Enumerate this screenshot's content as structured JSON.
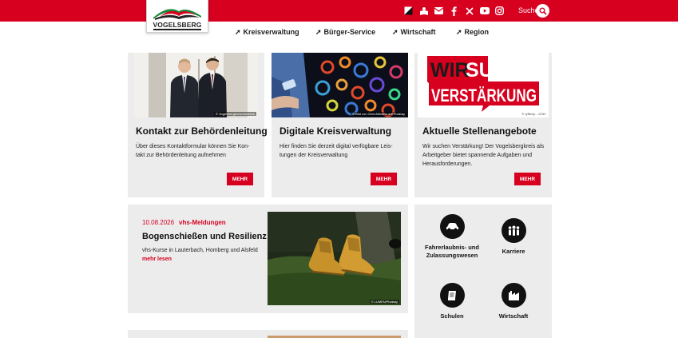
{
  "header": {
    "logo_text": "VOGELSBERG",
    "search_label": "Suche",
    "social": [
      "contrast-icon",
      "easy-language-icon",
      "mail-icon",
      "facebook-icon",
      "x-icon",
      "youtube-icon",
      "instagram-icon"
    ]
  },
  "nav": [
    {
      "label": "Kreisverwaltung"
    },
    {
      "label": "Bürger-Service"
    },
    {
      "label": "Wirtschaft"
    },
    {
      "label": "Region"
    }
  ],
  "cards": [
    {
      "title": "Kontakt zur Behördenleitung",
      "text": "Über dieses Kontaktformular können Sie Kon- takt zur Behördenleitung aufnehmen",
      "button": "MEHR",
      "credit": "© Vogelsbergkreis/Asbeeck"
    },
    {
      "title": "Digitale Kreisverwaltung",
      "text": "Hier finden Sie derzeit digital verfügbare Leis- tungen der Kreisverwaltung",
      "button": "MEHR",
      "credit": "© Bild von Gerd Altmann auf Pixabay"
    },
    {
      "title": "Aktuelle Stellenangebote",
      "text": "Wir suchen Verstärkung! Der Vogelsbergkreis als Arbeitgeber bietet spannende Aufgaben und Herausforderungen.",
      "button": "MEHR",
      "credit": "© ryffin1p - 123rf",
      "banner_line1": "WIR SUCHEN",
      "banner_line2": "VERSTÄRKUNG"
    }
  ],
  "news": {
    "date": "10.08.2026",
    "category": "vhs-Meldungen",
    "title": "Bogenschießen und Resilienz",
    "text": "vhs-Kurse in Lauterbach, Homberg und Alsfeld",
    "more": "mehr lesen",
    "credit": "© LUMEN/Pixabay"
  },
  "quicklinks": [
    {
      "label": "Fahrerlaubnis- und Zulassungswesen",
      "icon": "car-icon"
    },
    {
      "label": "Karriere",
      "icon": "people-icon"
    },
    {
      "label": "Schulen",
      "icon": "book-icon"
    },
    {
      "label": "Wirtschaft",
      "icon": "factory-icon"
    }
  ],
  "colors": {
    "brand_red": "#d7001f",
    "card_bg": "#ececec"
  }
}
